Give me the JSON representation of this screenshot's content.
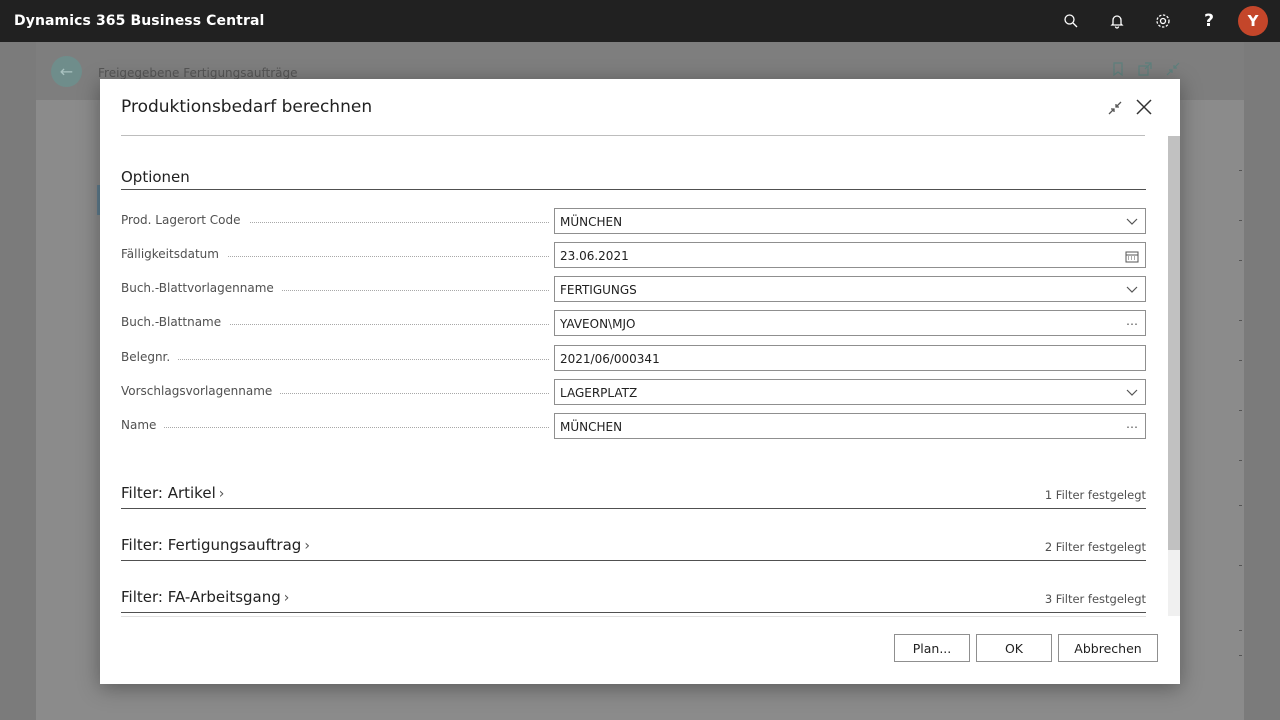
{
  "app": {
    "title": "Dynamics 365 Business Central",
    "avatar_initial": "Y",
    "icons": [
      "search-icon",
      "bell-icon",
      "gear-icon",
      "help-icon"
    ]
  },
  "background_page": {
    "title": "Freigegebene Fertigungsaufträge"
  },
  "dialog": {
    "title": "Produktionsbedarf berechnen",
    "section_title": "Optionen",
    "fields": [
      {
        "label": "Prod. Lagerort Code",
        "value": "MÜNCHEN",
        "icon": "chevron-down-icon"
      },
      {
        "label": "Fälligkeitsdatum",
        "value": "23.06.2021",
        "icon": "calendar-icon"
      },
      {
        "label": "Buch.-Blattvorlagenname",
        "value": "FERTIGUNGS",
        "icon": "chevron-down-icon"
      },
      {
        "label": "Buch.-Blattname",
        "value": "YAVEON\\MJO",
        "icon": "ellipsis-icon"
      },
      {
        "label": "Belegnr.",
        "value": "2021/06/000341",
        "icon": ""
      },
      {
        "label": "Vorschlagsvorlagenname",
        "value": "LAGERPLATZ",
        "icon": "chevron-down-icon"
      },
      {
        "label": "Name",
        "value": "MÜNCHEN",
        "icon": "ellipsis-icon"
      }
    ],
    "filters": [
      {
        "title": "Filter: Artikel",
        "count": "1 Filter festgelegt"
      },
      {
        "title": "Filter: Fertigungsauftrag",
        "count": "2 Filter festgelegt"
      },
      {
        "title": "Filter: FA-Arbeitsgang",
        "count": "3 Filter festgelegt"
      }
    ],
    "buttons": {
      "plan": "Plan...",
      "ok": "OK",
      "cancel": "Abbrechen"
    }
  },
  "colors": {
    "topbar": "#212121",
    "avatar": "#c4462a",
    "accent": "#00796b"
  }
}
